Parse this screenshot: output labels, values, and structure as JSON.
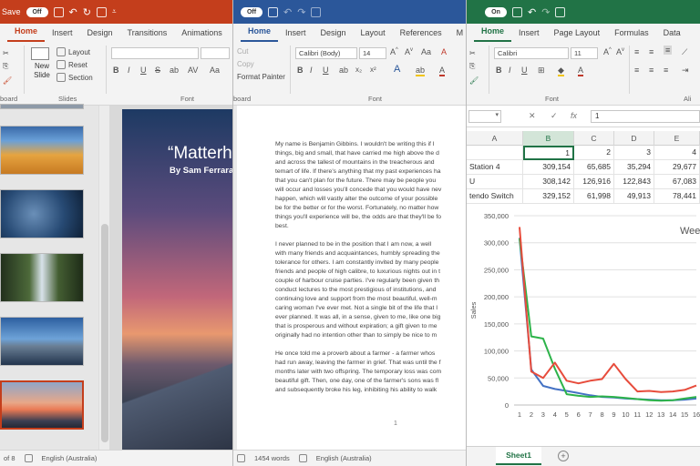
{
  "powerpoint": {
    "color": "#c43e1c",
    "autosave_label": "Save",
    "toggle_label": "Off",
    "tabs": [
      "Home",
      "Insert",
      "Design",
      "Transitions",
      "Animations"
    ],
    "ribbon": {
      "new_slide": "New Slide",
      "layout": "Layout",
      "reset": "Reset",
      "section": "Section",
      "slides_group": "Slides",
      "font_group": "Font",
      "board_group": "board"
    },
    "slide": {
      "title": "“Matterh",
      "subtitle": "By Sam Ferrara"
    },
    "status": {
      "slide_count": "of 8",
      "language": "English (Australia)"
    }
  },
  "word": {
    "color": "#2b579a",
    "toggle_label": "Off",
    "tabs": [
      "Home",
      "Insert",
      "Design",
      "Layout",
      "References",
      "M"
    ],
    "ribbon": {
      "cut": "Cut",
      "copy": "Copy",
      "format_painter": "Format Painter",
      "font_name": "Calibri (Body)",
      "font_size": "14",
      "font_group": "Font",
      "clipboard_group": "board"
    },
    "paragraphs": [
      "My name is Benjamin Gibbins. I wouldn't be writing this if I\nthings, big and small, that have carried me high above the d\nand across the tallest of mountains in the treacherous and\ntemart of life. If there's anything that my past experiences ha\nthat you can't plan for the future. There may be people you\nwill occur and losses you'll concede that you would have nev\nhappen, which will vastly alter the outcome of your possible\nbe for the better or for the worst. Fortunately, no matter how\nthings you'll experience will be, the odds are that they'll be fo\nbest.",
      "I never planned to be in the position that I am now, a well\nwith many friends and acquaintances, humbly spreading the\ntolerance for others. I am constantly invited by many people\nfriends and people of high calibre, to luxurious nights out in t\ncouple of harbour cruise parties. I've regularly been given th\nconduct lectures to the most prestigious of institutions, and\ncontinuing love and support from the most beautiful, well-m\ncaring woman I've ever met. Not a single bit of the life that I\never planned. It was all, in a sense, given to me, like one big\nthat is prosperous and without expiration; a gift given to me\noriginally had no intention other than to simply be nice to m",
      "He once told me a proverb about a farmer - a farmer whos\nhad run away, leaving the farmer in grief. That was until the f\nmonths later with two offspring. The temporary loss was com\nbeautiful gift. Then, one day, one of the farmer's sons was fl\nand subsequently broke his leg, inhibiting his ability to walk"
    ],
    "page_number": "1",
    "status": {
      "words": "1454 words",
      "language": "English (Australia)"
    }
  },
  "excel": {
    "color": "#217346",
    "toggle_label": "On",
    "tabs": [
      "Home",
      "Insert",
      "Page Layout",
      "Formulas",
      "Data"
    ],
    "ribbon": {
      "font_name": "Calibri",
      "font_size": "11",
      "font_group": "Font",
      "align_group": "Ali"
    },
    "formula_value": "1",
    "fx_label": "fx",
    "columns": [
      "A",
      "B",
      "C",
      "D",
      "E"
    ],
    "rows": [
      {
        "label": "",
        "values": [
          "1",
          "2",
          "3",
          "4"
        ]
      },
      {
        "label": "Station 4",
        "values": [
          "309,154",
          "65,685",
          "35,294",
          "29,677"
        ]
      },
      {
        "label": "U",
        "values": [
          "308,142",
          "126,916",
          "122,843",
          "67,083"
        ]
      },
      {
        "label": "tendo Switch",
        "values": [
          "329,152",
          "61,998",
          "49,913",
          "78,441"
        ]
      }
    ],
    "sheet_tab": "Sheet1",
    "add_sheet": "+"
  },
  "chart_data": {
    "type": "line",
    "title": "Wee",
    "ylabel": "Sales",
    "xlabel": "",
    "ylim": [
      0,
      350000
    ],
    "yticks": [
      "0",
      "50,000",
      "100,000",
      "150,000",
      "200,000",
      "250,000",
      "300,000",
      "350,000"
    ],
    "x": [
      1,
      2,
      3,
      4,
      5,
      6,
      7,
      8,
      9,
      10,
      11,
      12,
      13,
      14,
      15,
      16
    ],
    "xticks": [
      "1",
      "2",
      "3",
      "4",
      "5",
      "6",
      "7",
      "8",
      "9",
      "10",
      "11",
      "12",
      "13",
      "14",
      "15",
      "16"
    ],
    "series": [
      {
        "color": "#4472c4",
        "values": [
          309154,
          65685,
          35294,
          29677,
          26000,
          22000,
          18000,
          15000,
          14000,
          12000,
          11000,
          10000,
          9000,
          9000,
          10000,
          12000
        ]
      },
      {
        "color": "#2db34a",
        "values": [
          308142,
          126916,
          122843,
          67083,
          20000,
          17000,
          15000,
          16000,
          15000,
          13000,
          11000,
          9000,
          8000,
          9000,
          12000,
          15000
        ]
      },
      {
        "color": "#e74c3c",
        "values": [
          329152,
          61998,
          49913,
          78441,
          45000,
          40000,
          45000,
          48000,
          76000,
          48000,
          25000,
          26000,
          24000,
          25000,
          28000,
          36000
        ]
      }
    ]
  }
}
